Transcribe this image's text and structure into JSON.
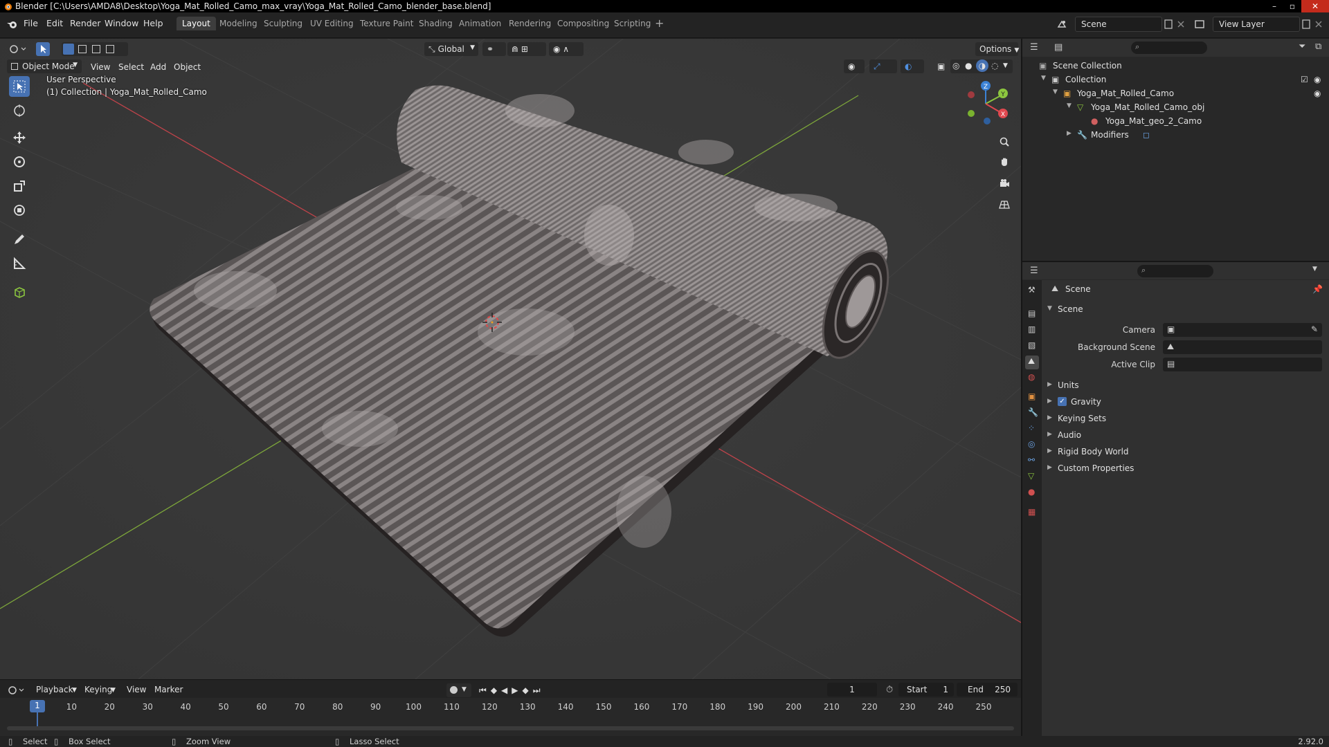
{
  "window": {
    "title": "Blender [C:\\Users\\AMDA8\\Desktop\\Yoga_Mat_Rolled_Camo_max_vray\\Yoga_Mat_Rolled_Camo_blender_base.blend]",
    "controls": [
      "–",
      "▫",
      "✕"
    ]
  },
  "menu": {
    "items": [
      "File",
      "Edit",
      "Render",
      "Window",
      "Help"
    ]
  },
  "workspaces": {
    "tabs": [
      "Layout",
      "Modeling",
      "Sculpting",
      "UV Editing",
      "Texture Paint",
      "Shading",
      "Animation",
      "Rendering",
      "Compositing",
      "Scripting"
    ],
    "active": "Layout",
    "add": "+"
  },
  "scene_selector": {
    "value": "Scene"
  },
  "view_layer_selector": {
    "value": "View Layer"
  },
  "viewport": {
    "mode": "Object Mode",
    "menus": [
      "View",
      "Select",
      "Add",
      "Object"
    ],
    "transform_orientation": "Global",
    "options_label": "Options",
    "info_line1": "User Perspective",
    "info_line2": "(1) Collection | Yoga_Mat_Rolled_Camo",
    "gizmo": {
      "x": "X",
      "y": "Y",
      "z": "Z"
    }
  },
  "timeline": {
    "menus": [
      "Playback",
      "Keying",
      "View",
      "Marker"
    ],
    "current_frame": "1",
    "start_label": "Start",
    "start_value": "1",
    "end_label": "End",
    "end_value": "250",
    "frame_marks": [
      "1",
      "10",
      "20",
      "30",
      "40",
      "50",
      "60",
      "70",
      "80",
      "90",
      "100",
      "110",
      "120",
      "130",
      "140",
      "150",
      "160",
      "170",
      "180",
      "190",
      "200",
      "210",
      "220",
      "230",
      "240",
      "250"
    ]
  },
  "statusbar": {
    "select": "Select",
    "box_select": "Box Select",
    "zoom_view": "Zoom View",
    "lasso_select": "Lasso Select",
    "version": "2.92.0"
  },
  "outliner": {
    "rows": [
      {
        "label": "Scene Collection"
      },
      {
        "label": "Collection"
      },
      {
        "label": "Yoga_Mat_Rolled_Camo"
      },
      {
        "label": "Yoga_Mat_Rolled_Camo_obj"
      },
      {
        "label": "Yoga_Mat_geo_2_Camo"
      },
      {
        "label": "Modifiers"
      }
    ]
  },
  "properties": {
    "context": "Scene",
    "panel_title": "Scene",
    "fields": [
      {
        "label": "Camera"
      },
      {
        "label": "Background Scene"
      },
      {
        "label": "Active Clip"
      }
    ],
    "panels": [
      "Units",
      "Gravity",
      "Keying Sets",
      "Audio",
      "Rigid Body World",
      "Custom Properties"
    ],
    "gravity_checked": true
  },
  "colors": {
    "accent": "#4772b3",
    "axis_x": "#e0484f",
    "axis_y": "#8cc63f",
    "axis_z": "#3b82d6"
  }
}
